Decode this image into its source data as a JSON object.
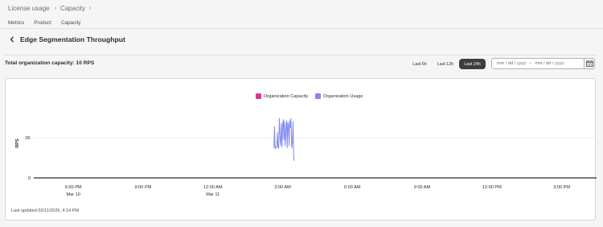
{
  "breadcrumb": {
    "items": [
      "License usage",
      "Capacity"
    ]
  },
  "tabs": [
    "Metrics",
    "Product",
    "Capacity"
  ],
  "page": {
    "title": "Edge Segmentation Throughput"
  },
  "summary": {
    "capacity_text": "Total organization capacity: 10 RPS"
  },
  "time_range": {
    "options": [
      "Last 6h",
      "Last 12h",
      "Last 24h"
    ],
    "selected": "Last 24h"
  },
  "date_range": {
    "start_placeholder": "mm / dd / yyyy",
    "separator": "–",
    "end_placeholder": "mm / dd / yyyy"
  },
  "legend": [
    {
      "label": "Organization Capacity",
      "color": "#d83790"
    },
    {
      "label": "Organization Usage",
      "color": "#8188f0"
    }
  ],
  "footer": {
    "last_updated": "Last updated 03/11/2026, 4:14 PM"
  },
  "chart_data": {
    "type": "line",
    "ylabel": "RPS",
    "yticks": [
      0,
      2000
    ],
    "ytick_labels": [
      "0",
      "2K"
    ],
    "ylim": [
      0,
      4000
    ],
    "xtick_labels": [
      [
        "6:00 PM",
        "Mar 10"
      ],
      [
        "9:00 PM",
        ""
      ],
      [
        "12:00 AM",
        "Mar 11"
      ],
      [
        "3:00 AM",
        ""
      ],
      [
        "6:00 AM",
        ""
      ],
      [
        "9:00 AM",
        ""
      ],
      [
        "12:00 PM",
        ""
      ],
      [
        "3:00 PM",
        ""
      ]
    ],
    "x_axis_hours": [
      18,
      21,
      24,
      27,
      30,
      33,
      36,
      39
    ],
    "xlim_hours": [
      16.3,
      40.5
    ],
    "series": [
      {
        "name": "Organization Usage",
        "color": "#8188f0",
        "x_hours": [
          26.63,
          26.65,
          26.68,
          26.7,
          26.72,
          26.75,
          26.78,
          26.8,
          26.83,
          26.86,
          26.89,
          26.92,
          26.95,
          26.98,
          27.0,
          27.03,
          27.06,
          27.08,
          27.11,
          27.14,
          27.17,
          27.2,
          27.22,
          27.25,
          27.28,
          27.3,
          27.33,
          27.36,
          27.39,
          27.42,
          27.45,
          27.47,
          27.5
        ],
        "values": [
          1500,
          2550,
          1450,
          1500,
          1500,
          1650,
          2250,
          1500,
          1480,
          2950,
          2050,
          1600,
          2700,
          1550,
          2600,
          2900,
          1900,
          2800,
          1600,
          2400,
          2850,
          1500,
          2750,
          2650,
          1600,
          2850,
          2500,
          2950,
          1500,
          1750,
          2800,
          1200,
          850
        ]
      }
    ],
    "grid": true,
    "legend_position": "top-center"
  }
}
